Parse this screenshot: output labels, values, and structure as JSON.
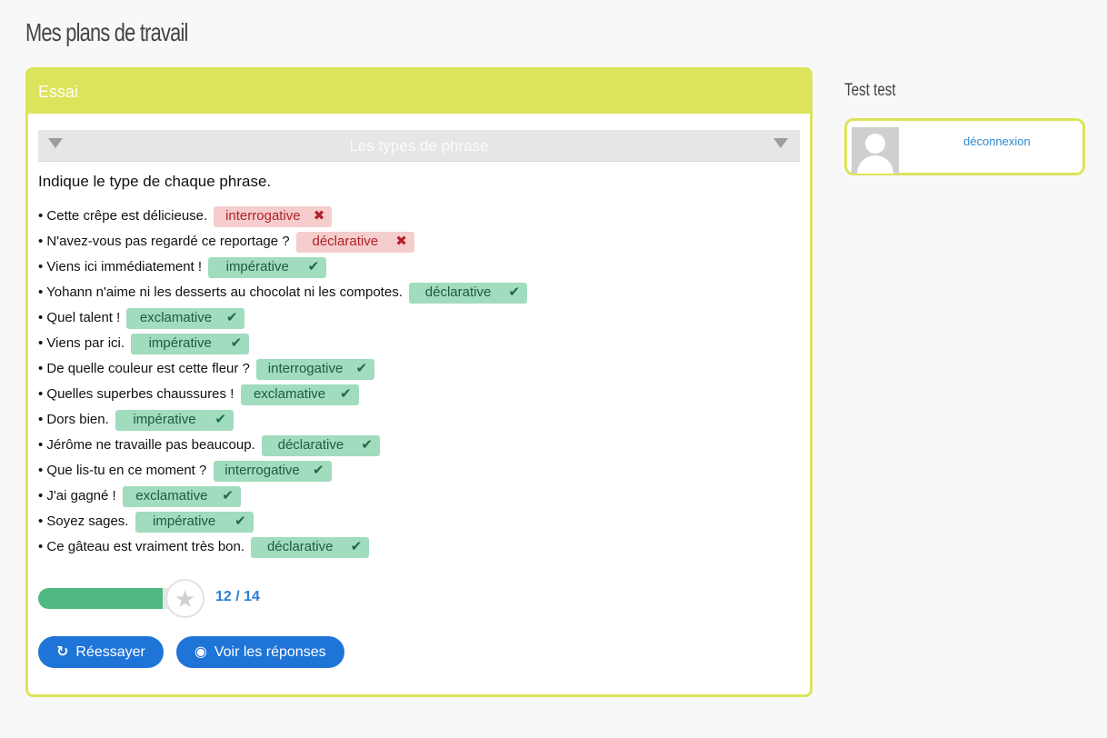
{
  "page_title": "Mes plans de travail",
  "card": {
    "title": "Essai",
    "section_title": "Les types de phrase",
    "instruction": "Indique le type de chaque phrase.",
    "items": [
      {
        "sentence": "Cette crêpe est délicieuse.",
        "answer": "interrogative",
        "correct": false,
        "mark": "✖"
      },
      {
        "sentence": "N'avez-vous pas regardé ce reportage ?",
        "answer": "déclarative",
        "correct": false,
        "mark": "✖"
      },
      {
        "sentence": "Viens ici immédiatement !",
        "answer": "impérative",
        "correct": true,
        "mark": "✔"
      },
      {
        "sentence": "Yohann n'aime ni les desserts au chocolat ni les compotes.",
        "answer": "déclarative",
        "correct": true,
        "mark": "✔"
      },
      {
        "sentence": "Quel talent !",
        "answer": "exclamative",
        "correct": true,
        "mark": "✔"
      },
      {
        "sentence": "Viens par ici.",
        "answer": "impérative",
        "correct": true,
        "mark": "✔"
      },
      {
        "sentence": "De quelle couleur est cette fleur ?",
        "answer": "interrogative",
        "correct": true,
        "mark": "✔"
      },
      {
        "sentence": "Quelles superbes chaussures !",
        "answer": "exclamative",
        "correct": true,
        "mark": "✔"
      },
      {
        "sentence": "Dors bien.",
        "answer": "impérative",
        "correct": true,
        "mark": "✔"
      },
      {
        "sentence": "Jérôme ne travaille pas beaucoup.",
        "answer": "déclarative",
        "correct": true,
        "mark": "✔"
      },
      {
        "sentence": "Que lis-tu en ce moment ?",
        "answer": "interrogative",
        "correct": true,
        "mark": "✔"
      },
      {
        "sentence": "J'ai gagné !",
        "answer": "exclamative",
        "correct": true,
        "mark": "✔"
      },
      {
        "sentence": "Soyez sages.",
        "answer": "impérative",
        "correct": true,
        "mark": "✔"
      },
      {
        "sentence": "Ce gâteau est vraiment très bon.",
        "answer": "déclarative",
        "correct": true,
        "mark": "✔"
      }
    ],
    "progress": {
      "score_label": "12 / 14",
      "fraction": 0.857
    },
    "buttons": {
      "retry": "Réessayer",
      "show_answers": "Voir les réponses"
    }
  },
  "sidebar": {
    "user_name": "Test test",
    "logout_label": "déconnexion"
  },
  "colors": {
    "accent": "#dce45b",
    "correct": "#a0dcbd",
    "wrong": "#f5cdcd",
    "primary_button": "#1f74d8",
    "progress": "#4fb981"
  }
}
